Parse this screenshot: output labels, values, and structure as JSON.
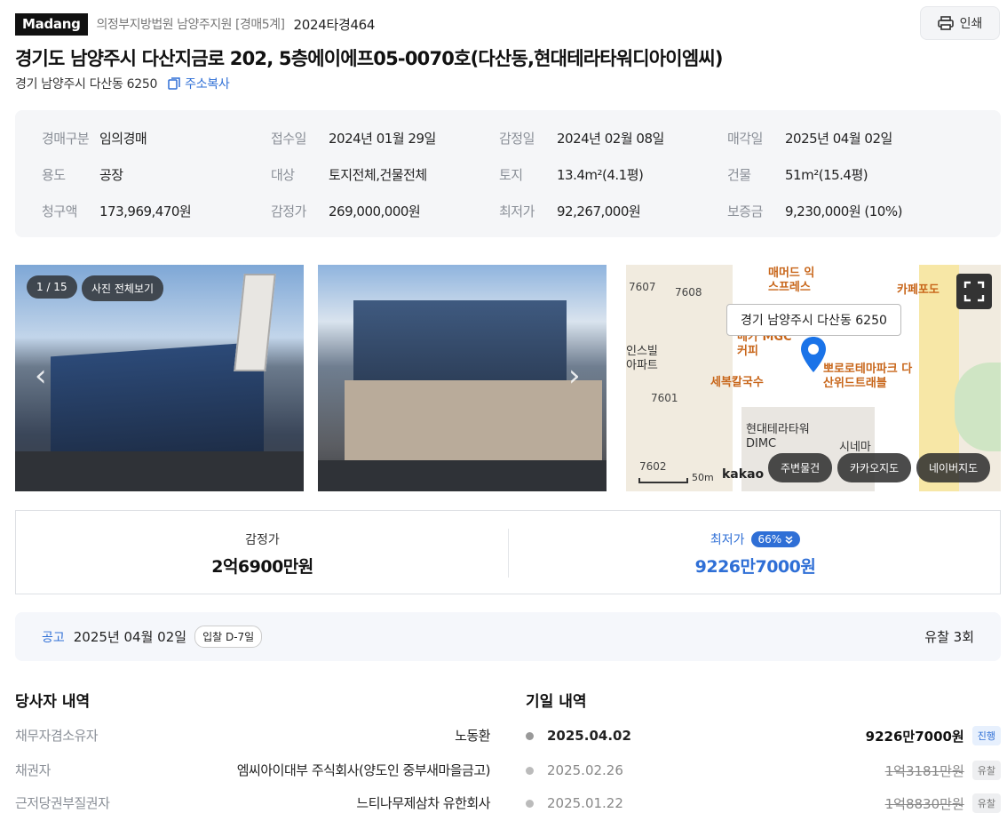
{
  "header": {
    "brand": "Madang",
    "court": "의정부지방법원 남양주지원 [경매5계]",
    "case_no": "2024타경464",
    "print_label": "인쇄"
  },
  "property": {
    "title": "경기도 남양주시 다산지금로 202, 5층에이에프05-0070호(다산동,현대테라타워디아이엠씨)",
    "lot_address": "경기 남양주시 다산동 6250",
    "copy_label": "주소복사"
  },
  "info": {
    "rows": [
      [
        {
          "k": "경매구분",
          "v": "임의경매"
        },
        {
          "k": "접수일",
          "v": "2024년 01월 29일"
        },
        {
          "k": "감정일",
          "v": "2024년 02월 08일"
        },
        {
          "k": "매각일",
          "v": "2025년 04월 02일"
        }
      ],
      [
        {
          "k": "용도",
          "v": "공장"
        },
        {
          "k": "대상",
          "v": "토지전체,건물전체"
        },
        {
          "k": "토지",
          "v": "13.4m²(4.1평)"
        },
        {
          "k": "건물",
          "v": "51m²(15.4평)"
        }
      ],
      [
        {
          "k": "청구액",
          "v": "173,969,470원"
        },
        {
          "k": "감정가",
          "v": "269,000,000원"
        },
        {
          "k": "최저가",
          "v": "92,267,000원"
        },
        {
          "k": "보증금",
          "v": "9,230,000원 (10%)"
        }
      ]
    ]
  },
  "photos": {
    "counter": "1 / 15",
    "view_all": "사진 전체보기"
  },
  "map": {
    "callout": "경기 남양주시 다산동 6250",
    "scale": "50m",
    "provider": "kakao",
    "labels": [
      "7607",
      "7608",
      "7601",
      "7602"
    ],
    "pois": [
      "매머드 익스프레스",
      "카페포도",
      "메가 MGC커피",
      "뽀로로테마파크 다산위드트래블",
      "세복칼국수",
      "현대테라타워 DIMC",
      "시네마",
      "인스빌 아파트"
    ],
    "buttons": [
      "주변물건",
      "카카오지도",
      "네이버지도"
    ]
  },
  "price": {
    "appraisal_label": "감정가",
    "appraisal_value": "2억6900만원",
    "min_label": "최저가",
    "min_pct": "66%",
    "min_value": "9226만7000원"
  },
  "notice": {
    "label": "공고",
    "date": "2025년 04월 02일",
    "dday": "입찰 D-7일",
    "fail_count": "유찰 3회"
  },
  "parties": {
    "title": "당사자 내역",
    "rows": [
      {
        "k": "채무자겸소유자",
        "v": "노동환"
      },
      {
        "k": "채권자",
        "v": "엠씨아이대부 주식회사(양도인 중부새마을금고)"
      },
      {
        "k": "근저당권부질권자",
        "v": "느티나무제삼차 유한회사"
      }
    ]
  },
  "schedule": {
    "title": "기일 내역",
    "rows": [
      {
        "date": "2025.04.02",
        "amount": "9226만7000원",
        "status": "진행"
      },
      {
        "date": "2025.02.26",
        "amount": "1억3181만원",
        "status": "유찰"
      },
      {
        "date": "2025.01.22",
        "amount": "1억8830만원",
        "status": "유찰"
      }
    ]
  },
  "colors": {
    "accent": "#2f6fd6",
    "map_pin": "#1a73e8",
    "poi": "#c8661a"
  }
}
